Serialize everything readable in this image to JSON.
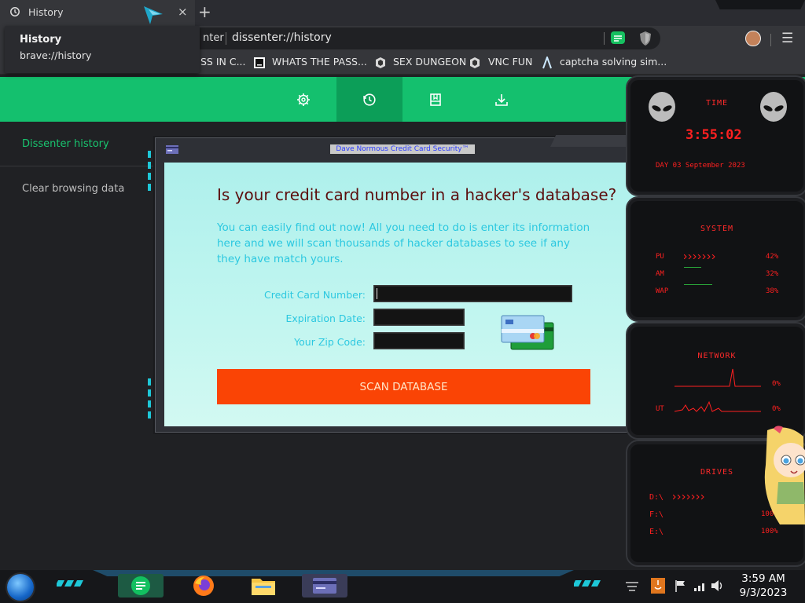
{
  "tab": {
    "title": "History",
    "close": "×",
    "new_tab": "+"
  },
  "tooltip": {
    "title": "History",
    "url": "brave://history"
  },
  "address_bar": {
    "site_fragment": "nter",
    "url": "dissenter://history"
  },
  "bookmarks": [
    "SS IN C...",
    "WHATS THE PASS...",
    "SEX DUNGEON",
    "VNC FUN",
    "captcha solving sim..."
  ],
  "menu_icon": "☰",
  "page_toolbar": {
    "icons": [
      "gear-icon",
      "history-icon",
      "bookmarks-icon",
      "download-icon"
    ],
    "active": "history-icon",
    "accent_color": "#14c06e"
  },
  "sidebar": {
    "items": [
      {
        "label": "Dissenter history",
        "active": true
      },
      {
        "label": "Clear browsing data",
        "active": false
      }
    ]
  },
  "dialog": {
    "window_title": "Dave Normous Credit Card Security™",
    "heading": "Is your credit card number in a hacker's database?",
    "description": "You can easily find out now! All you need to do is enter its information here and we will scan thousands of hacker databases to see if any they have match yours.",
    "fields": [
      {
        "label": "Credit Card Number:",
        "value": ""
      },
      {
        "label": "Expiration Date:",
        "value": ""
      },
      {
        "label": "Your Zip Code:",
        "value": ""
      }
    ],
    "button": "SCAN DATABASE",
    "button_color": "#fa4405"
  },
  "widgets": {
    "time": {
      "title": "TIME",
      "clock": "3:55:02",
      "date": "DAY 03 September 2023"
    },
    "system": {
      "title": "SYSTEM",
      "rows": [
        {
          "label": "PU",
          "value": "42%"
        },
        {
          "label": "AM",
          "value": "32%"
        },
        {
          "label": "WAP",
          "value": "38%"
        }
      ]
    },
    "network": {
      "title": "NETWORK",
      "rows": [
        {
          "label": "",
          "value": "0%"
        },
        {
          "label": "UT",
          "value": "0%"
        }
      ]
    },
    "drives": {
      "title": "DRIVES",
      "rows": [
        {
          "label": "D:\\",
          "value": ""
        },
        {
          "label": "F:\\",
          "value": "100%"
        },
        {
          "label": "E:\\",
          "value": "100%"
        }
      ]
    },
    "accent_color": "#ff2020"
  },
  "taskbar": {
    "clock_time": "3:59 AM",
    "clock_date": "9/3/2023"
  }
}
